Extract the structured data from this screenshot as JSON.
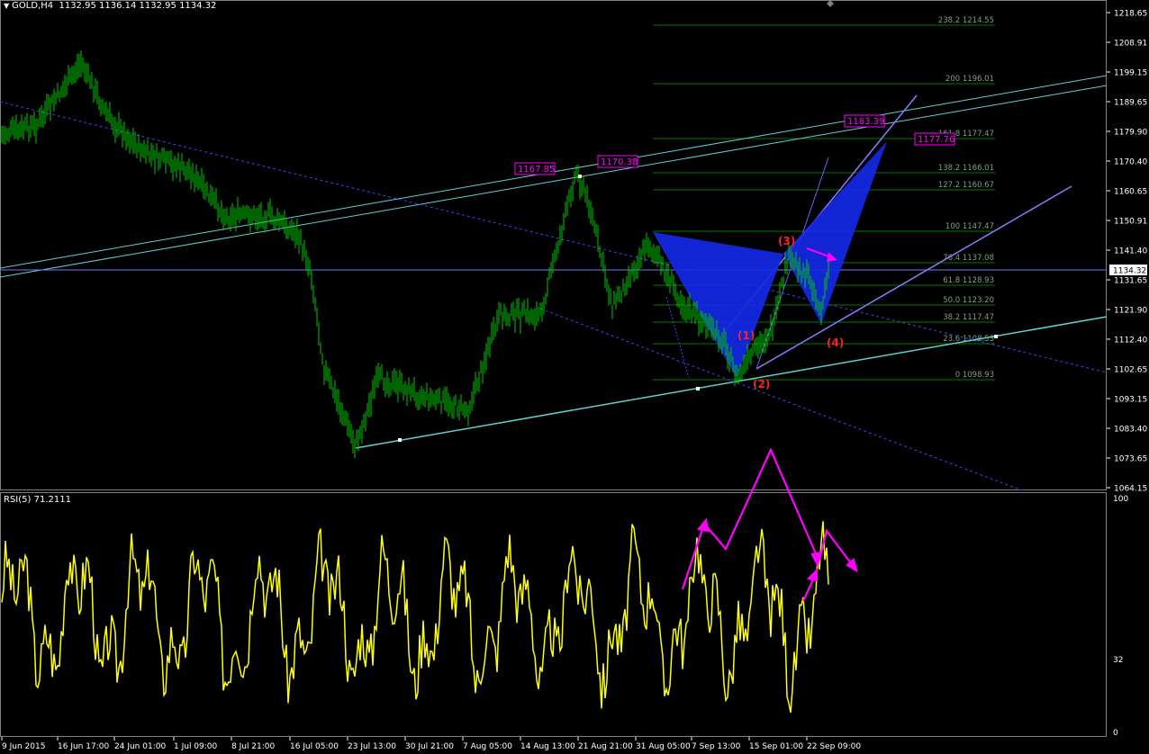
{
  "header": {
    "symbol": "GOLD,H4",
    "ohlc": "1132.95 1136.14 1132.95 1134.32"
  },
  "subwindow": {
    "label": "RSI(5) 71.2111"
  },
  "price_axis": [
    "1218.65",
    "1208.91",
    "1199.15",
    "1189.65",
    "1179.90",
    "1170.40",
    "1160.65",
    "1150.91",
    "1141.40",
    "1131.65",
    "1121.90",
    "1112.40",
    "1102.65",
    "1093.15",
    "1083.40",
    "1073.65",
    "1064.15"
  ],
  "current_price": "1134.32",
  "rsi_axis": [
    "100",
    "32",
    "0"
  ],
  "time_axis": [
    "9 Jun 2015",
    "16 Jun 17:00",
    "24 Jun 01:00",
    "1 Jul 09:00",
    "8 Jul 21:00",
    "16 Jul 05:00",
    "23 Jul 13:00",
    "30 Jul 21:00",
    "7 Aug 05:00",
    "14 Aug 13:00",
    "21 Aug 21:00",
    "31 Aug 05:00",
    "7 Sep 13:00",
    "15 Sep 01:00",
    "22 Sep 09:00"
  ],
  "fib_levels": [
    "238.2 1214.55",
    "200 1196.01",
    "161.8 1177.47",
    "138.2 1166.01",
    "127.2 1160.67",
    "100 1147.47",
    "76.4 1137.08",
    "61.8 1128.93",
    "50.0 1123.20",
    "38.2 1117.47",
    "23.6 1108.53",
    "0 1098.93"
  ],
  "price_tags": [
    "1167.85",
    "1170.38",
    "1183.39",
    "1177.76"
  ],
  "wave_labels": [
    "(1)",
    "(2)",
    "(3)",
    "(4)"
  ],
  "colors": {
    "candle": "#00c800",
    "rsi": "#ffff00",
    "fib": "#007800",
    "trend": "#5fd0d0",
    "channel": "#4040ff",
    "pattern_fill": "#0f1ee0",
    "arrow": "#ff00ff",
    "wave": "#ff2020",
    "tag": "#ff00ff",
    "purple_line": "#8a7cff"
  }
}
